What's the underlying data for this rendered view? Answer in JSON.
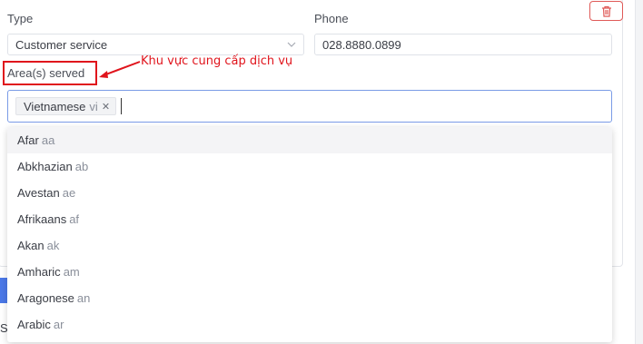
{
  "form": {
    "type_label": "Type",
    "type_value": "Customer service",
    "phone_label": "Phone",
    "phone_value": "028.8880.0899",
    "areas_label": "Area(s) served",
    "selected_tags": [
      {
        "name": "Vietnamese",
        "code": "vi"
      }
    ]
  },
  "annotation": {
    "text": "Khu vực cung cấp dịch vụ",
    "color": "#e0141c"
  },
  "dropdown": {
    "options": [
      {
        "name": "Afar",
        "code": "aa"
      },
      {
        "name": "Abkhazian",
        "code": "ab"
      },
      {
        "name": "Avestan",
        "code": "ae"
      },
      {
        "name": "Afrikaans",
        "code": "af"
      },
      {
        "name": "Akan",
        "code": "ak"
      },
      {
        "name": "Amharic",
        "code": "am"
      },
      {
        "name": "Aragonese",
        "code": "an"
      },
      {
        "name": "Arabic",
        "code": "ar"
      }
    ]
  },
  "background": {
    "partial_text": "Sc"
  },
  "icons": {
    "delete": "trash-icon",
    "select_arrow": "chevron-down-icon",
    "tag_remove": "close-icon"
  },
  "colors": {
    "accent_border": "#7a9be6",
    "danger": "#e05a58",
    "primary_button": "#4b79e8"
  }
}
